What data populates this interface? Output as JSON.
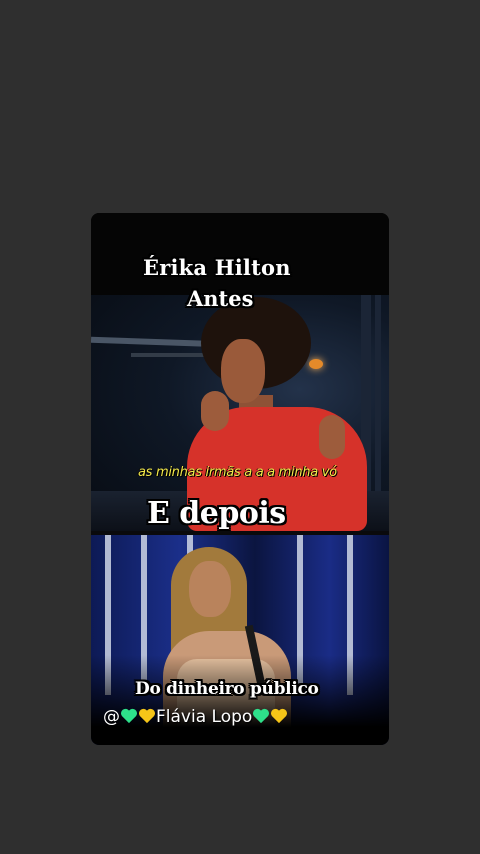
{
  "video": {
    "title_name": "Érika Hilton",
    "title_before": "Antes",
    "subtitle": "as minhas irmãs a a a minha vó",
    "title_after": "E depois",
    "caption": "Do dinheiro público",
    "credit": {
      "at": "@",
      "name": "Flávia Lopo",
      "heart_colors": [
        "#2ee08a",
        "#f5c518"
      ]
    }
  },
  "colors": {
    "background": "#2f2f2f",
    "subtitle": "#f2e84a"
  }
}
